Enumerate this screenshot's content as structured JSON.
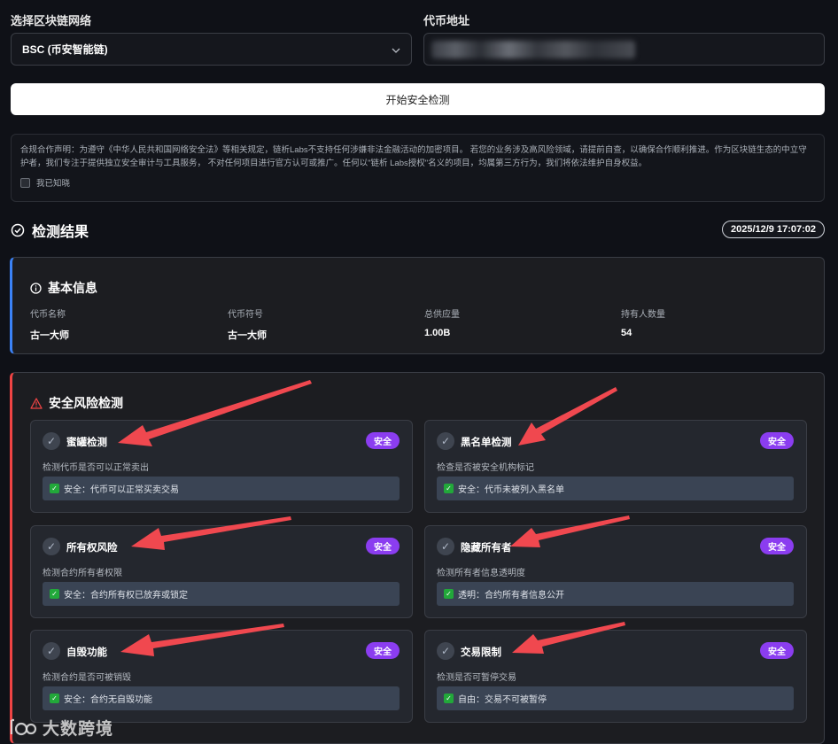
{
  "form": {
    "network_label": "选择区块链网络",
    "network_value": "BSC (币安智能链)",
    "address_label": "代币地址",
    "start_button": "开始安全检测"
  },
  "notice": {
    "text": "合规合作声明：为遵守《中华人民共和国网络安全法》等相关规定，链析Labs不支持任何涉嫌非法金融活动的加密项目。 若您的业务涉及高风险领域，请提前自查，以确保合作顺利推进。作为区块链生态的中立守护者，我们专注于提供独立安全审计与工具服务， 不对任何项目进行官方认可或推广。任何以\"链析 Labs授权\"名义的项目，均属第三方行为，我们将依法维护自身权益。",
    "ack_label": "我已知晓"
  },
  "results": {
    "title": "检测结果",
    "timestamp": "2025/12/9 17:07:02"
  },
  "basic": {
    "title": "基本信息",
    "fields": [
      {
        "key": "代币名称",
        "value": "古一大师"
      },
      {
        "key": "代币符号",
        "value": "古一大师"
      },
      {
        "key": "总供应量",
        "value": "1.00B"
      },
      {
        "key": "持有人数量",
        "value": "54"
      }
    ]
  },
  "risk": {
    "title": "安全风险检测",
    "checks": [
      {
        "title": "蜜罐检测",
        "badge": "安全",
        "desc": "检测代币是否可以正常卖出",
        "result": "安全：代币可以正常买卖交易"
      },
      {
        "title": "黑名单检测",
        "badge": "安全",
        "desc": "检查是否被安全机构标记",
        "result": "安全：代币未被列入黑名单"
      },
      {
        "title": "所有权风险",
        "badge": "安全",
        "desc": "检测合约所有者权限",
        "result": "安全：合约所有权已放弃或锁定"
      },
      {
        "title": "隐藏所有者",
        "badge": "安全",
        "desc": "检测所有者信息透明度",
        "result": "透明：合约所有者信息公开"
      },
      {
        "title": "自毁功能",
        "badge": "安全",
        "desc": "检测合约是否可被销毁",
        "result": "安全：合约无自毁功能"
      },
      {
        "title": "交易限制",
        "badge": "安全",
        "desc": "检测是否可暂停交易",
        "result": "自由：交易不可被暂停"
      }
    ]
  },
  "watermark": "大数跨境",
  "colors": {
    "accent_purple": "#8b3df0",
    "basic_border": "#3b82f6",
    "risk_border": "#ef4444",
    "annotation_arrow": "#f0484f"
  }
}
